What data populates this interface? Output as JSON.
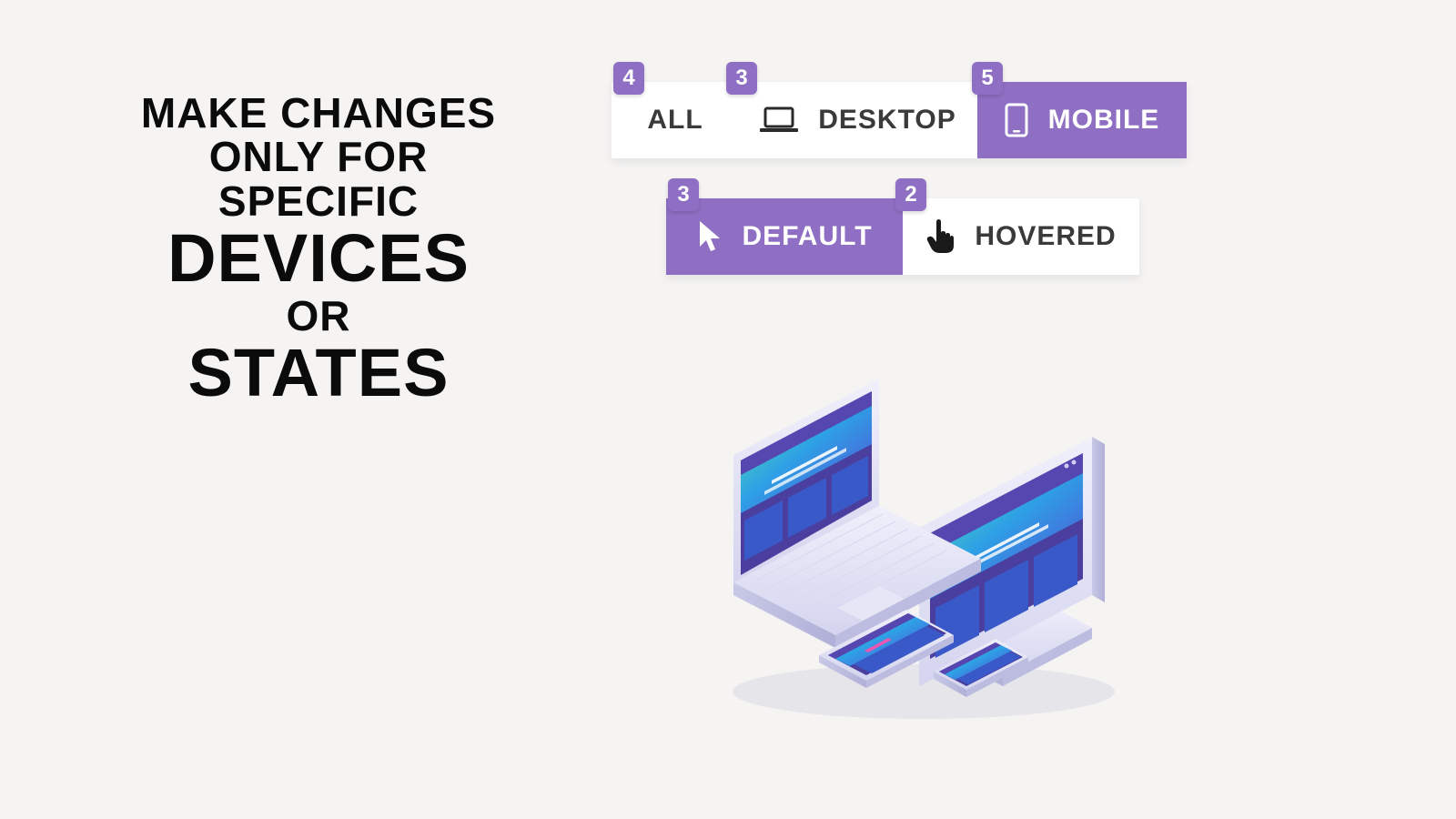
{
  "headline": {
    "line1": "MAKE CHANGES",
    "line2": "ONLY FOR",
    "line3": "SPECIFIC",
    "line4": "DEVICES",
    "line5": "OR",
    "line6": "STATES"
  },
  "device_bar": {
    "tabs": [
      {
        "label": "ALL",
        "badge": "4",
        "active": false
      },
      {
        "label": "DESKTOP",
        "badge": "3",
        "active": false
      },
      {
        "label": "MOBILE",
        "badge": "5",
        "active": true
      }
    ]
  },
  "state_bar": {
    "tabs": [
      {
        "label": "DEFAULT",
        "badge": "3",
        "active": true
      },
      {
        "label": "HOVERED",
        "badge": "2",
        "active": false
      }
    ]
  },
  "colors": {
    "accent": "#8f6fc3"
  }
}
